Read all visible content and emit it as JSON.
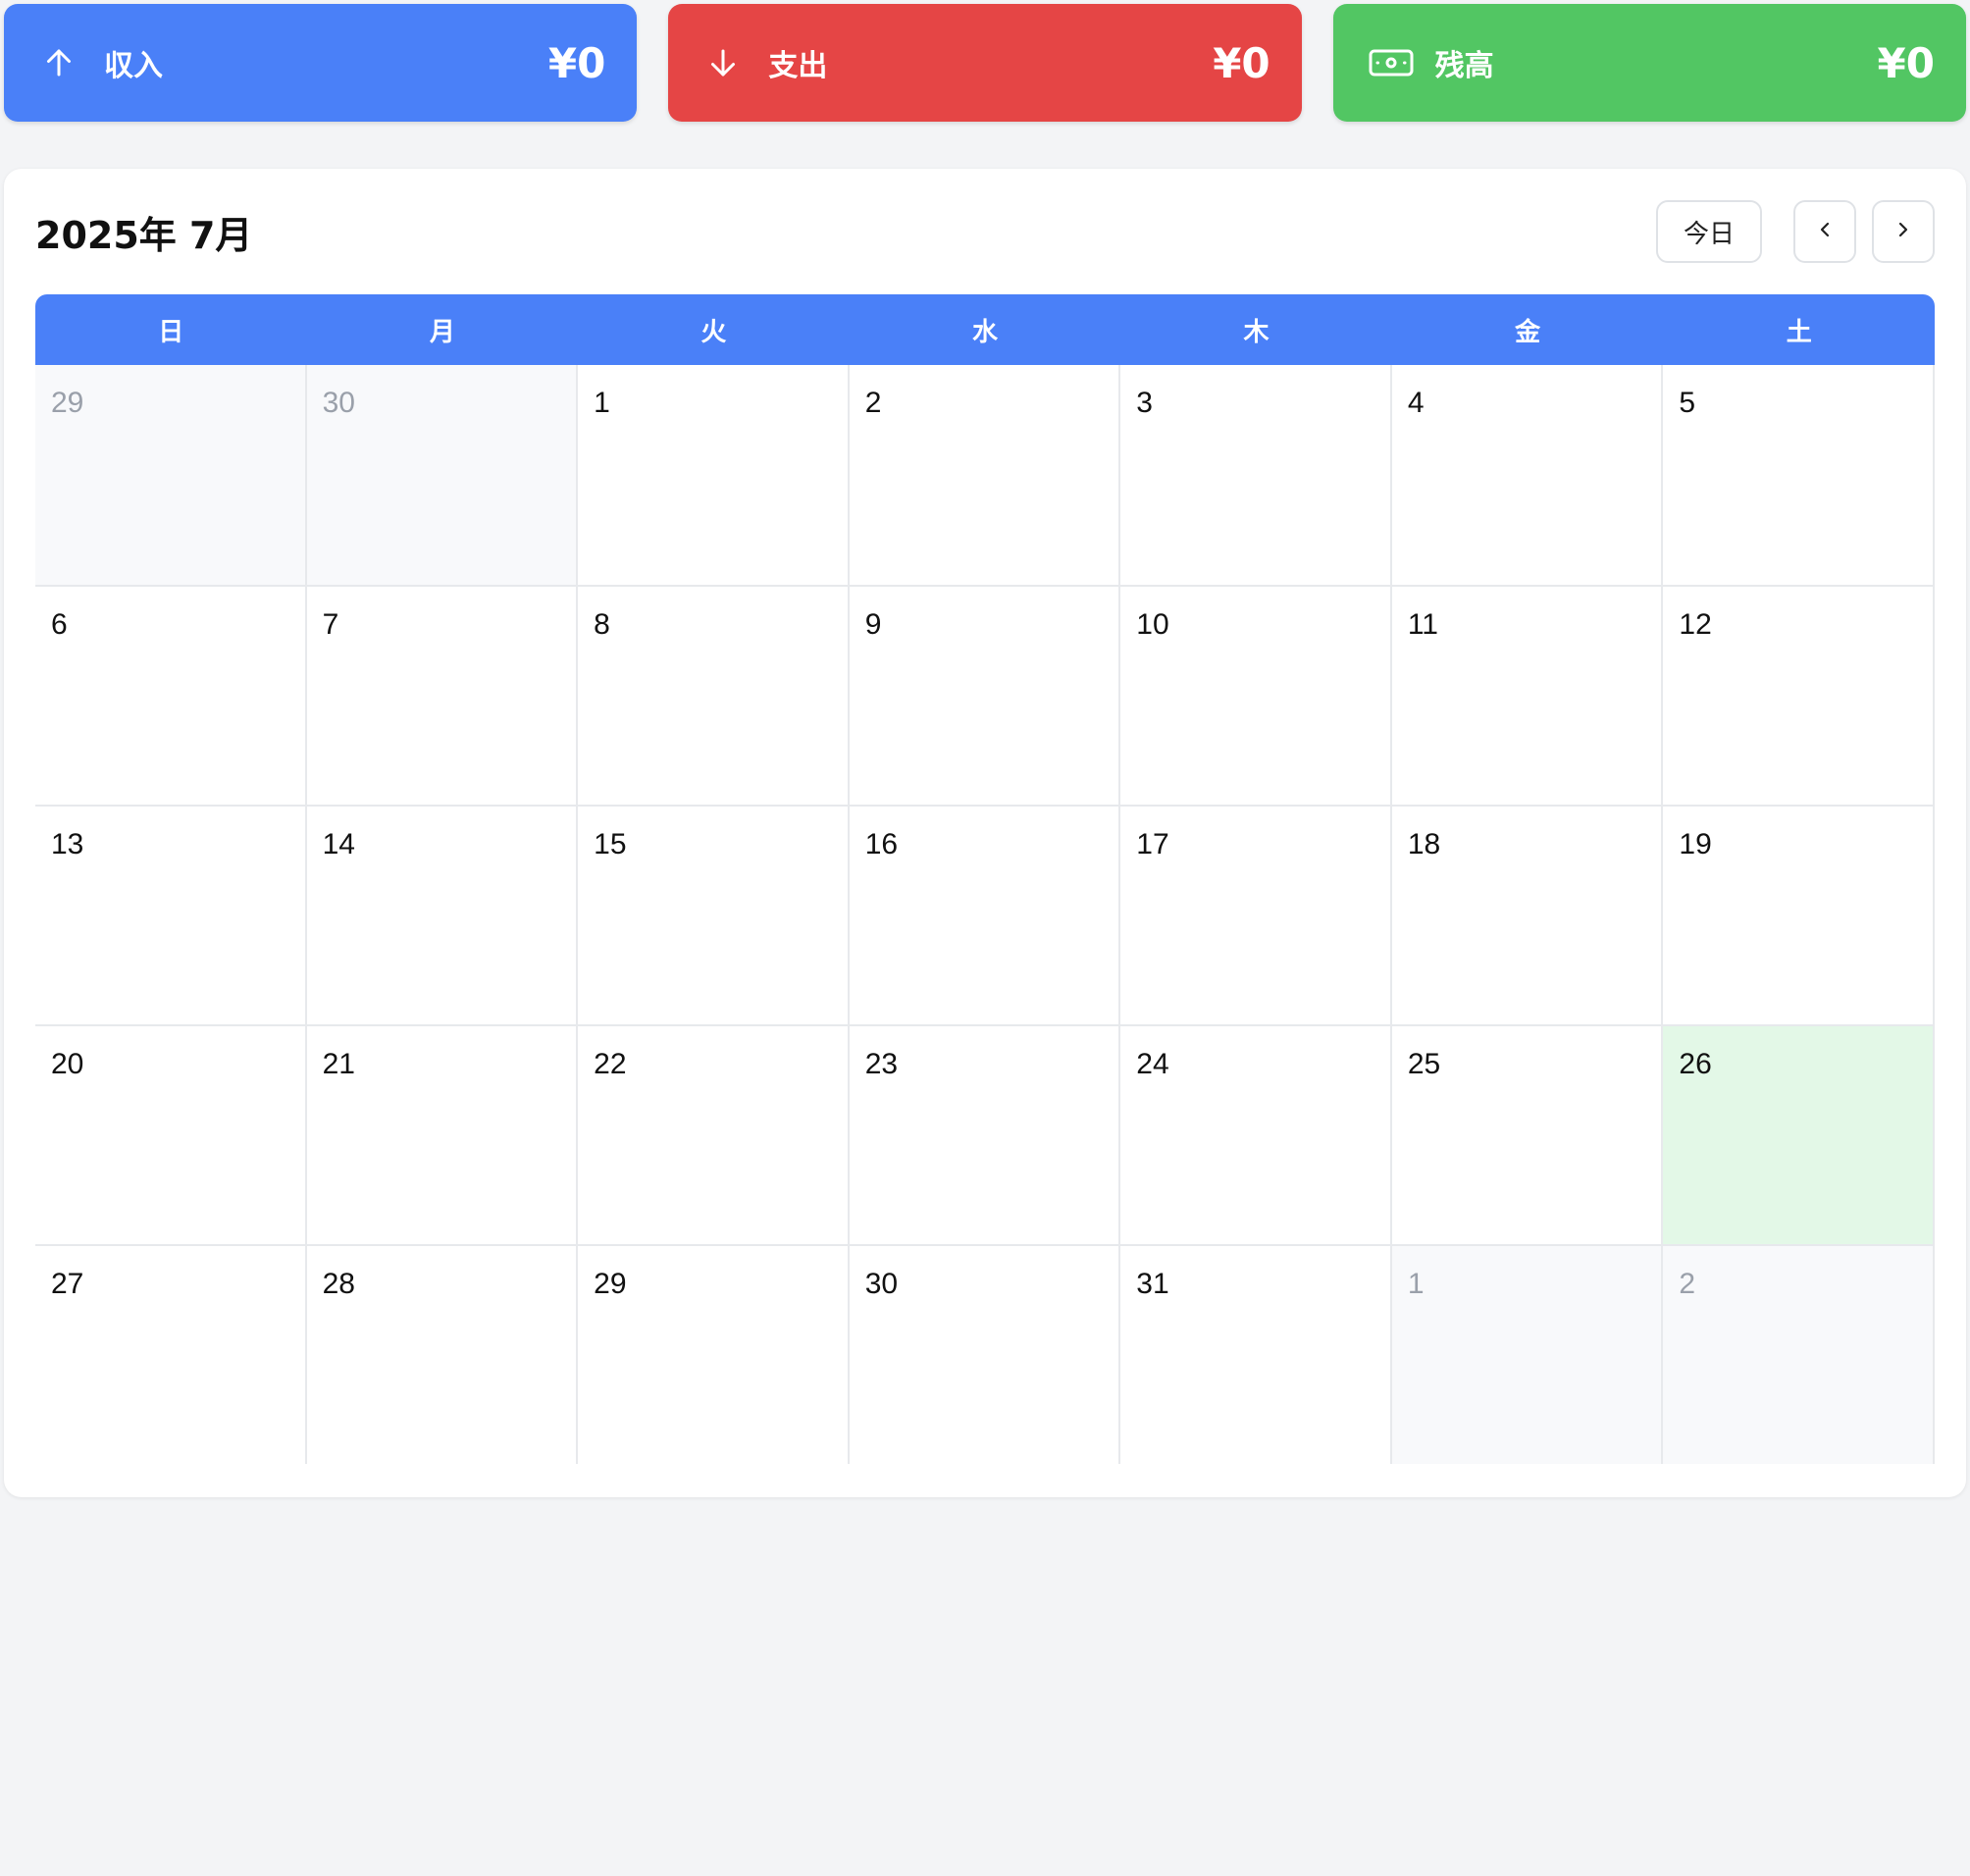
{
  "summary": {
    "income": {
      "label": "収入",
      "amount": "¥0",
      "icon": "arrow-up-icon",
      "color": "#4a80f8"
    },
    "expense": {
      "label": "支出",
      "amount": "¥0",
      "icon": "arrow-down-icon",
      "color": "#e54545"
    },
    "balance": {
      "label": "残高",
      "amount": "¥0",
      "icon": "banknote-icon",
      "color": "#52c663"
    }
  },
  "calendar": {
    "title": "2025年 7月",
    "today_button": "今日",
    "prev_icon": "chevron-left-icon",
    "next_icon": "chevron-right-icon",
    "header_color": "#4a80f8",
    "weekdays": [
      "日",
      "月",
      "火",
      "水",
      "木",
      "金",
      "土"
    ],
    "days": [
      {
        "n": "29",
        "other": true
      },
      {
        "n": "30",
        "other": true
      },
      {
        "n": "1"
      },
      {
        "n": "2"
      },
      {
        "n": "3"
      },
      {
        "n": "4"
      },
      {
        "n": "5"
      },
      {
        "n": "6"
      },
      {
        "n": "7"
      },
      {
        "n": "8"
      },
      {
        "n": "9"
      },
      {
        "n": "10"
      },
      {
        "n": "11"
      },
      {
        "n": "12"
      },
      {
        "n": "13"
      },
      {
        "n": "14"
      },
      {
        "n": "15"
      },
      {
        "n": "16"
      },
      {
        "n": "17"
      },
      {
        "n": "18"
      },
      {
        "n": "19"
      },
      {
        "n": "20"
      },
      {
        "n": "21"
      },
      {
        "n": "22"
      },
      {
        "n": "23"
      },
      {
        "n": "24"
      },
      {
        "n": "25"
      },
      {
        "n": "26",
        "today": true
      },
      {
        "n": "27"
      },
      {
        "n": "28"
      },
      {
        "n": "29"
      },
      {
        "n": "30"
      },
      {
        "n": "31"
      },
      {
        "n": "1",
        "other": true
      },
      {
        "n": "2",
        "other": true
      }
    ]
  }
}
